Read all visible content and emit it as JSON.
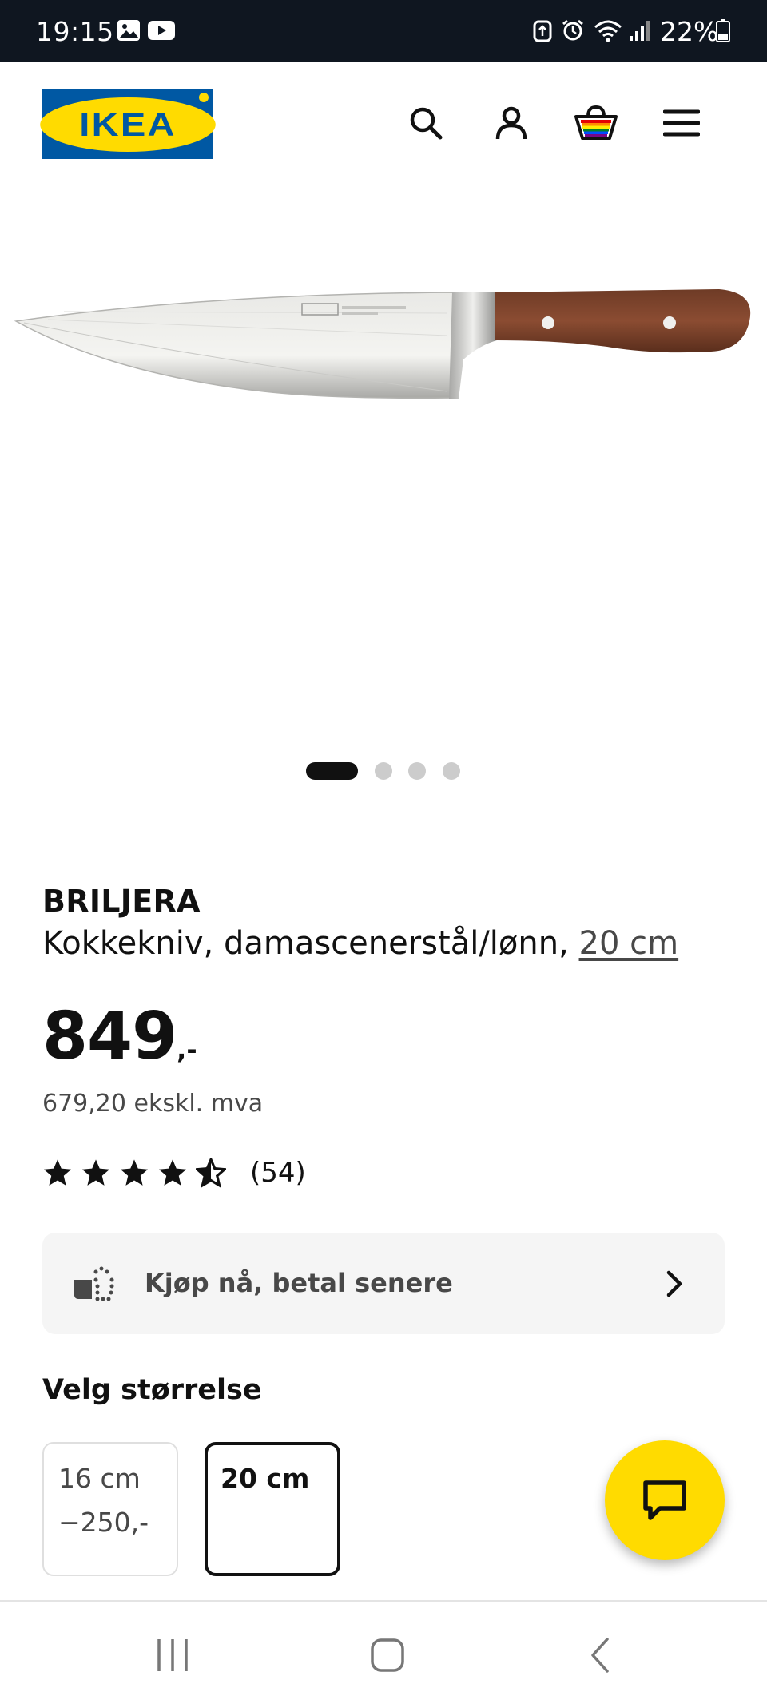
{
  "status_bar": {
    "time": "19:15",
    "battery": "22%"
  },
  "header": {
    "logo_text": "IKEA",
    "icons": [
      "search-icon",
      "account-icon",
      "basket-icon",
      "menu-icon"
    ],
    "colors": {
      "brand_blue": "#0058a3",
      "brand_yellow": "#ffdb00"
    }
  },
  "gallery": {
    "image_count": 4,
    "active_index": 0
  },
  "product": {
    "name": "BRILJERA",
    "description": "Kokkekniv, damascenerstål/lønn,",
    "size_link": "20 cm",
    "price_integer": "849",
    "price_suffix": ",-",
    "price_ex_vat": "679,20 ekskl. mva",
    "rating_stars": 4.5,
    "review_count": "(54)"
  },
  "bnpl": {
    "label": "Kjøp nå, betal senere"
  },
  "size_selector": {
    "title": "Velg størrelse",
    "options": [
      {
        "name": "16 cm",
        "price_diff": "−250,-",
        "selected": false
      },
      {
        "name": "20 cm",
        "price_diff": "",
        "selected": true
      }
    ]
  },
  "chat": {
    "icon": "chat-icon",
    "color": "#ffdb00"
  },
  "system_nav": {
    "icons": [
      "recents-icon",
      "home-icon",
      "back-icon"
    ]
  }
}
